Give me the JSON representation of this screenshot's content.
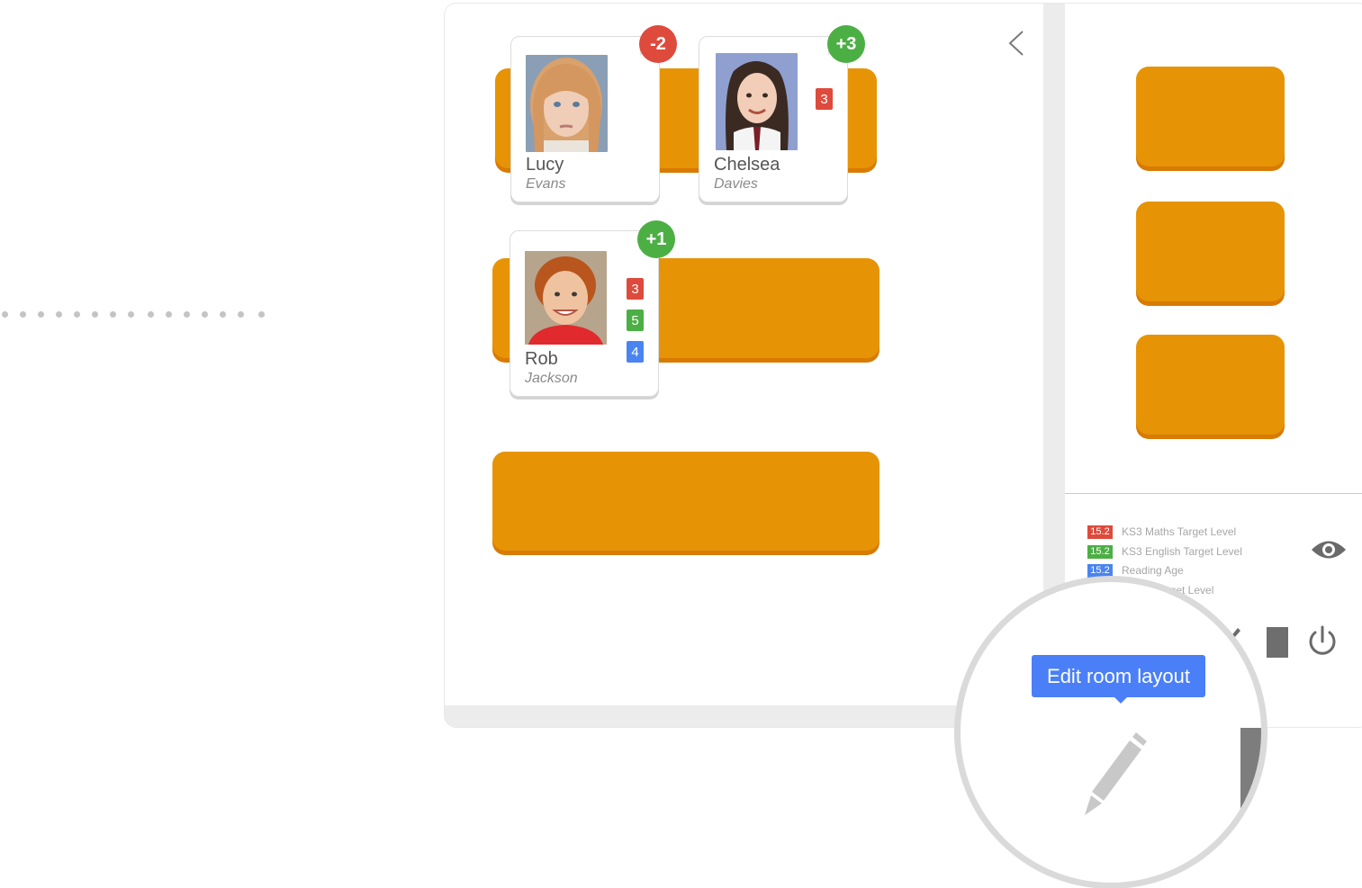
{
  "students": [
    {
      "first": "Lucy",
      "last": "Evans",
      "score": "-2",
      "tags": []
    },
    {
      "first": "Chelsea",
      "last": "Davies",
      "score": "+3",
      "tags": [
        "3"
      ]
    },
    {
      "first": "Rob",
      "last": "Jackson",
      "score": "+1",
      "tags": [
        "3",
        "5",
        "4"
      ]
    }
  ],
  "legend": [
    {
      "value": "15.2",
      "label": "KS3 Maths Target Level",
      "color": "#de4a3c"
    },
    {
      "value": "15.2",
      "label": "KS3 English Target Level",
      "color": "#4caf44"
    },
    {
      "value": "15.2",
      "label": "Reading Age",
      "color": "#4a84f0"
    },
    {
      "value": "",
      "label": "Target Level",
      "color": "#ffffff"
    }
  ],
  "tooltip": {
    "text": "Edit room layout"
  },
  "colors": {
    "desk": "#e69406",
    "accent": "#4a7ff7",
    "negative": "#de4a3c",
    "positive": "#4caf44"
  },
  "icons": [
    "back-chevron-icon",
    "eye-icon",
    "pencil-icon",
    "stop-icon",
    "power-icon"
  ]
}
